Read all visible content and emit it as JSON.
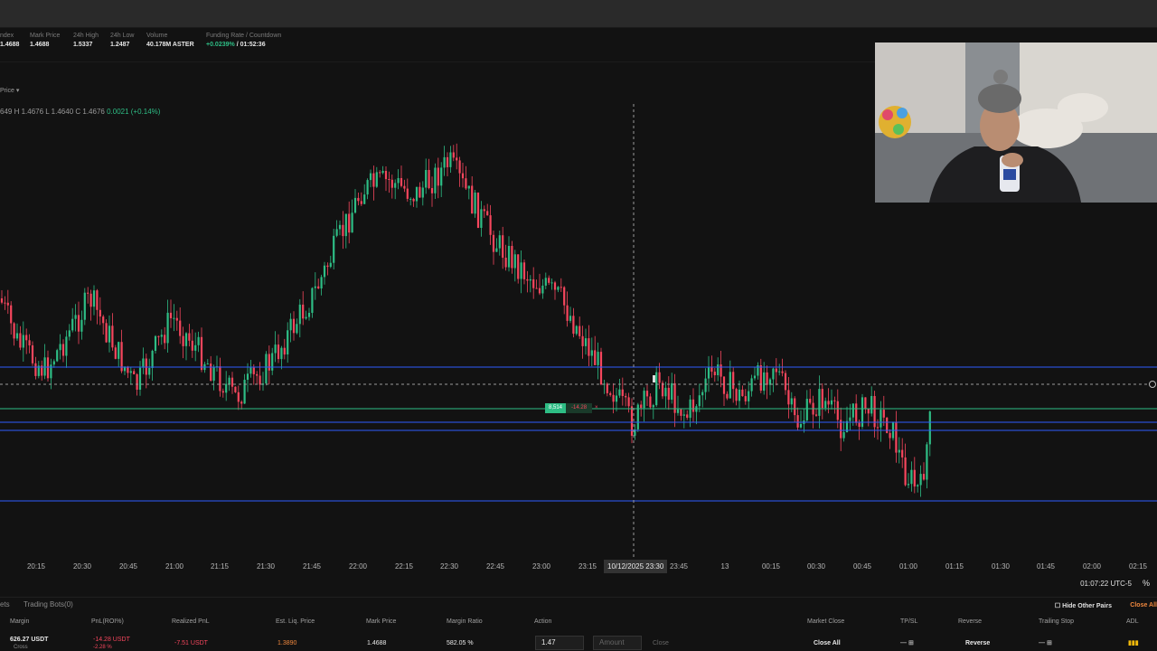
{
  "stats": {
    "index": {
      "label": "ndex",
      "value": "1.4688"
    },
    "mark_price": {
      "label": "Mark Price",
      "value": "1.4688"
    },
    "high_24h": {
      "label": "24h High",
      "value": "1.5337"
    },
    "low_24h": {
      "label": "24h Low",
      "value": "1.2487"
    },
    "volume": {
      "label": "Volume",
      "value": "40.178M ASTER"
    },
    "funding": {
      "label": "Funding Rate / Countdown",
      "rate": "+0.0239%",
      "countdown": "/ 01:52:36"
    }
  },
  "chart_controls": {
    "price_type": "Price ▾"
  },
  "ohlc": {
    "o": "649",
    "h": "H 1.4676",
    "l": "L 1.4640",
    "c": "C 1.4676",
    "change": "0.0021 (+0.14%)"
  },
  "position_marker": {
    "qty": "8,514",
    "pnl": "-14.28",
    "close": "×"
  },
  "time_axis": {
    "ticks": [
      "20:15",
      "20:30",
      "20:45",
      "21:00",
      "21:15",
      "21:30",
      "21:45",
      "22:00",
      "22:15",
      "22:30",
      "22:45",
      "23:00",
      "23:15",
      "23:45",
      "13",
      "00:15",
      "00:30",
      "00:45",
      "01:00",
      "01:15",
      "01:30",
      "01:45",
      "02:00",
      "02:15"
    ],
    "crosshair_label": "10/12/2025  23:30",
    "clock": "01:07:22 UTC-5",
    "percent_toggle": "%"
  },
  "bottom_tabs": {
    "assets": "ets",
    "trading_bots": "Trading Bots(0)",
    "hide_other_pairs": "Hide Other Pairs",
    "close_all": "Close All"
  },
  "positions_table": {
    "headers": [
      "Margin",
      "PnL(ROI%)",
      "Realized PnL",
      "Est. Liq. Price",
      "Mark Price",
      "Margin Ratio",
      "Action",
      "Market Close",
      "TP/SL",
      "Reverse",
      "Trailing Stop",
      "ADL"
    ],
    "row": {
      "margin": "626.27 USDT",
      "margin_mode": "Cross",
      "pnl": "-14.28 USDT",
      "roi": "-2.28 %",
      "realized_pnl": "-7.51 USDT",
      "est_liq_price": "1.3890",
      "mark_price": "1.4688",
      "margin_ratio": "582.05 %",
      "price_input": "1.47",
      "amount_placeholder": "Amount",
      "close_label": "Close",
      "close_all_label": "Close All",
      "reverse_label": "Reverse"
    }
  },
  "colors": {
    "up": "#2ebd85",
    "down": "#f6465d",
    "level_line": "#2f5cff",
    "position_line": "#2ebd85",
    "accent": "#f0883e"
  }
}
